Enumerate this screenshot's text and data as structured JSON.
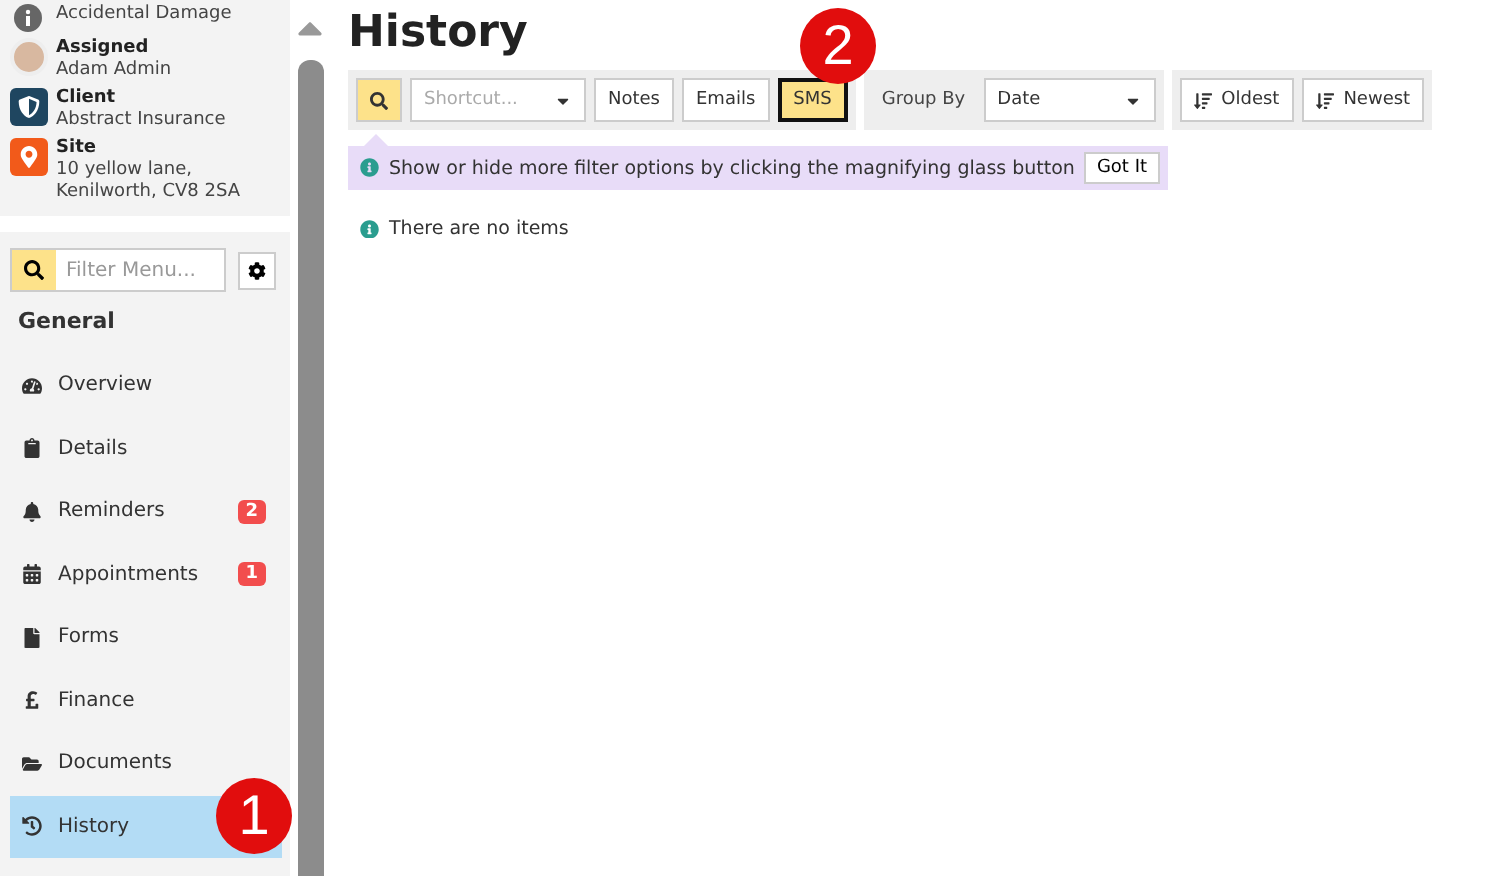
{
  "case_info": [
    {
      "kind": "info",
      "value": "Accidental Damage"
    },
    {
      "kind": "avatar",
      "label": "Assigned",
      "value": "Adam Admin"
    },
    {
      "kind": "client",
      "label": "Client",
      "value": "Abstract Insurance"
    },
    {
      "kind": "site",
      "label": "Site",
      "value": "10 yellow lane, Kenilworth, CV8 2SA"
    }
  ],
  "menu_filter": {
    "placeholder": "Filter Menu..."
  },
  "menu_section": "General",
  "menu_items": [
    {
      "label": "Overview",
      "selected": false
    },
    {
      "label": "Details",
      "selected": false
    },
    {
      "label": "Reminders",
      "badge": "2",
      "selected": false
    },
    {
      "label": "Appointments",
      "badge": "1",
      "selected": false
    },
    {
      "label": "Forms",
      "selected": false
    },
    {
      "label": "Finance",
      "selected": false
    },
    {
      "label": "Documents",
      "selected": false
    },
    {
      "label": "History",
      "selected": true
    }
  ],
  "page_title": "History",
  "toolbar": {
    "shortcut": {
      "placeholder": "Shortcut..."
    },
    "type_filters": [
      {
        "label": "Notes",
        "selected": false
      },
      {
        "label": "Emails",
        "selected": false
      },
      {
        "label": "SMS",
        "selected": true
      }
    ],
    "group_by": {
      "label": "Group By",
      "value": "Date"
    },
    "sort_buttons": [
      "Oldest",
      "Newest"
    ]
  },
  "hint": {
    "text": "Show or hide more filter options by clicking the magnifying glass button",
    "button": "Got It"
  },
  "empty_message": "There are no items",
  "step_markers": [
    "1",
    "2"
  ]
}
